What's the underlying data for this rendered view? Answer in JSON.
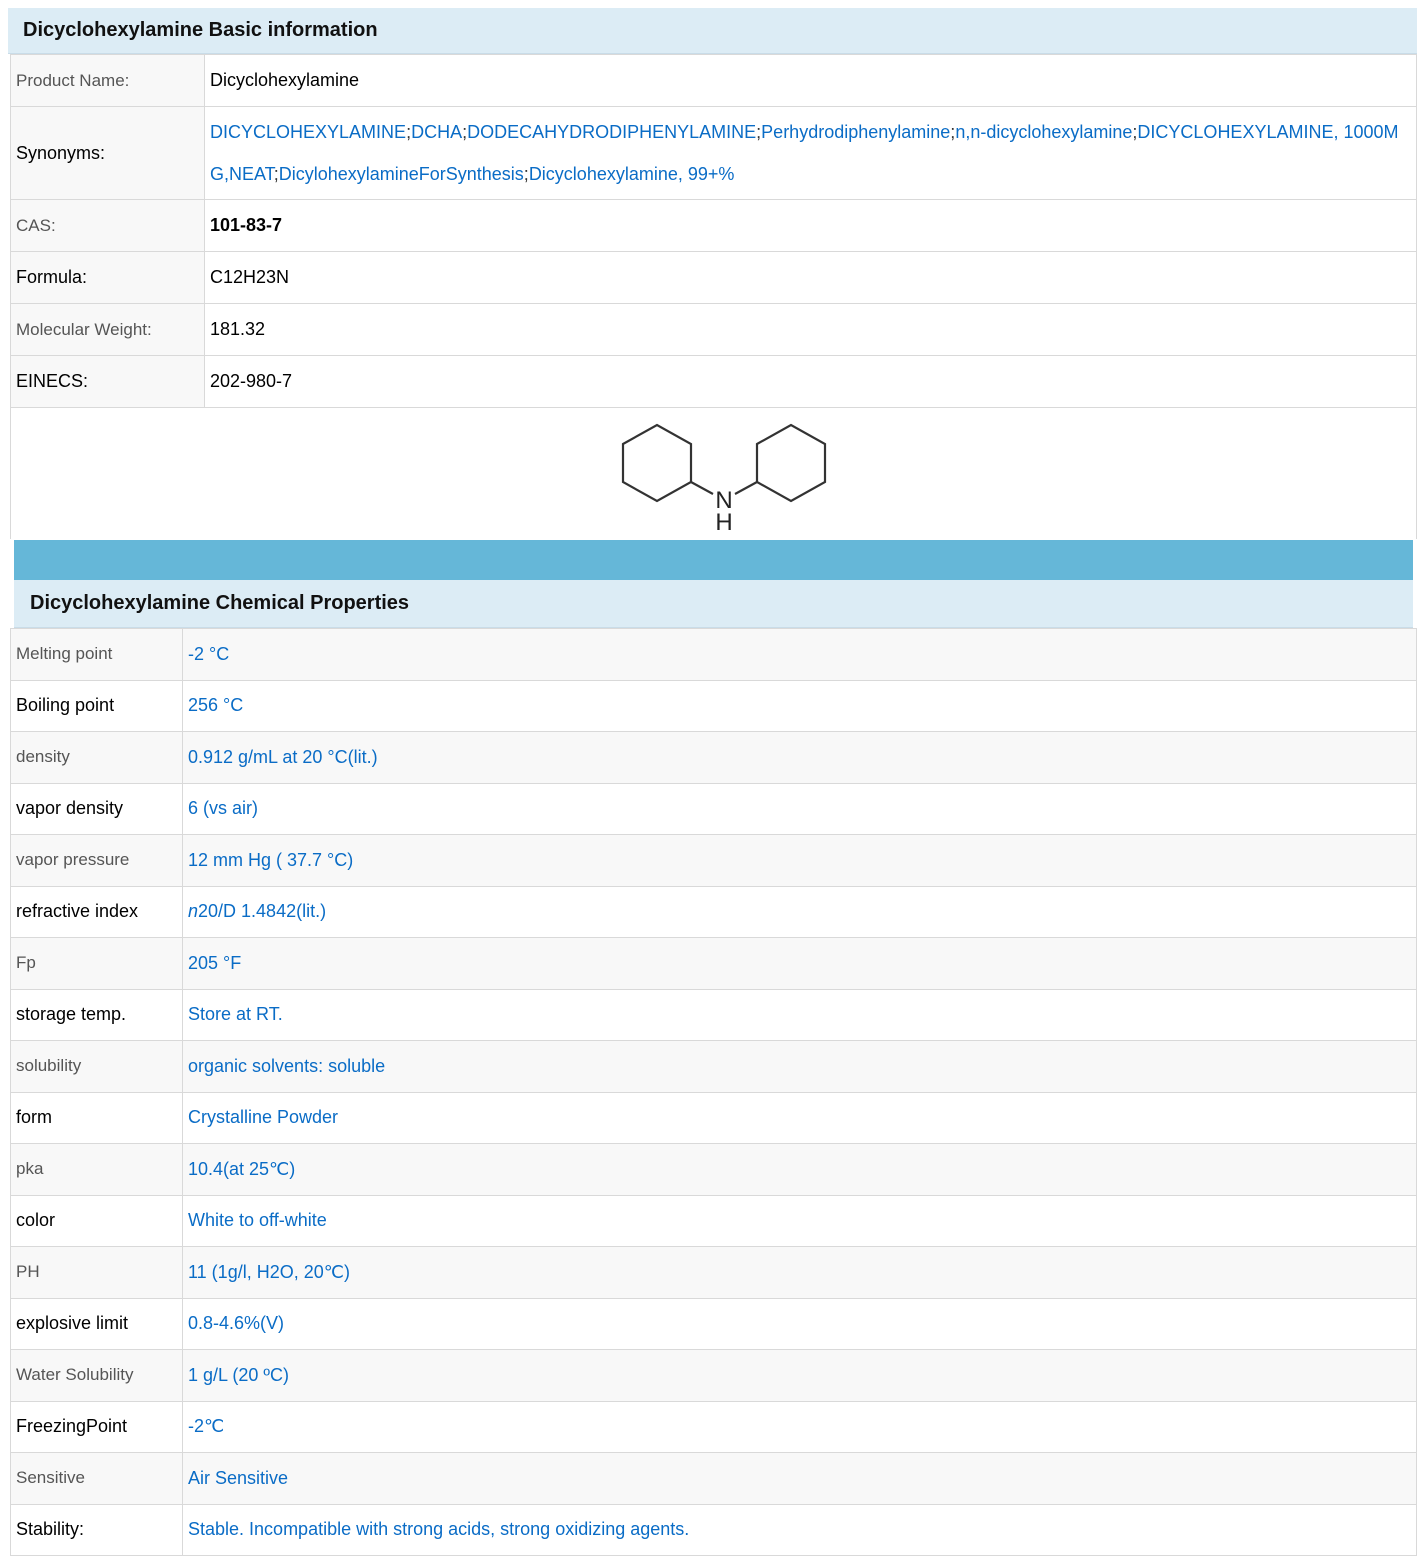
{
  "basic": {
    "title": "Dicyclohexylamine  Basic  information",
    "product_name_label": "Product  Name:",
    "product_name": "Dicyclohexylamine",
    "synonyms_label": "Synonyms:",
    "synonyms": [
      "DICYCLOHEXYLAMINE",
      "DCHA",
      "DODECAHYDRODIPHENYLAMINE",
      "Perhydrodiphenylamine",
      "n,n-dicyclohexylamine",
      "DICYCLOHEXYLAMINE,  1000MG,NEAT",
      "DicylohexylamineForSynthesis",
      "Dicyclohexylamine,  99+%"
    ],
    "synonym_separator": ";",
    "cas_label": "CAS:",
    "cas": "101-83-7",
    "formula_label": "Formula:",
    "formula": "C12H23N",
    "mw_label": "Molecular  Weight:",
    "mw": "181.32",
    "einecs_label": "EINECS:",
    "einecs": "202-980-7",
    "structure": {
      "n_label": "N",
      "h_label": "H"
    }
  },
  "chem": {
    "title": "Dicyclohexylamine  Chemical  Properties",
    "rows": [
      {
        "label": "Melting  point",
        "value": "-2  °C"
      },
      {
        "label": "Boiling  point",
        "value": "256  °C"
      },
      {
        "label": "density",
        "value": "0.912 g/mL  at  20 °C(lit.)"
      },
      {
        "label": "vapor  density",
        "value": "6  (vs  air)"
      },
      {
        "label": "vapor  pressure",
        "value": "12  mm  Hg  (  37.7  °C)"
      },
      {
        "label": "refractive  index",
        "value_prefix": "n",
        "value": "20/D 1.4842(lit.)"
      },
      {
        "label": "Fp",
        "value": "205 °F"
      },
      {
        "label": "storage  temp.",
        "value": "Store  at  RT."
      },
      {
        "label": "solubility",
        "value": "organic  solvents:  soluble"
      },
      {
        "label": "form",
        "value": "Crystalline  Powder"
      },
      {
        "label": "pka",
        "value": "10.4(at  25℃)"
      },
      {
        "label": "color",
        "value": "White  to  off-white"
      },
      {
        "label": "PH",
        "value": "11  (1g/l,  H2O,  20℃)"
      },
      {
        "label": "explosive  limit",
        "value": "0.8-4.6%(V)"
      },
      {
        "label": "Water  Solubility",
        "value": "1  g/L  (20  ºC)"
      },
      {
        "label": "FreezingPoint",
        "value": "-2℃"
      },
      {
        "label": "Sensitive",
        "value": "Air  Sensitive"
      },
      {
        "label": "Stability:",
        "value": "Stable.  Incompatible  with  strong  acids,  strong  oxidizing  agents."
      }
    ]
  }
}
